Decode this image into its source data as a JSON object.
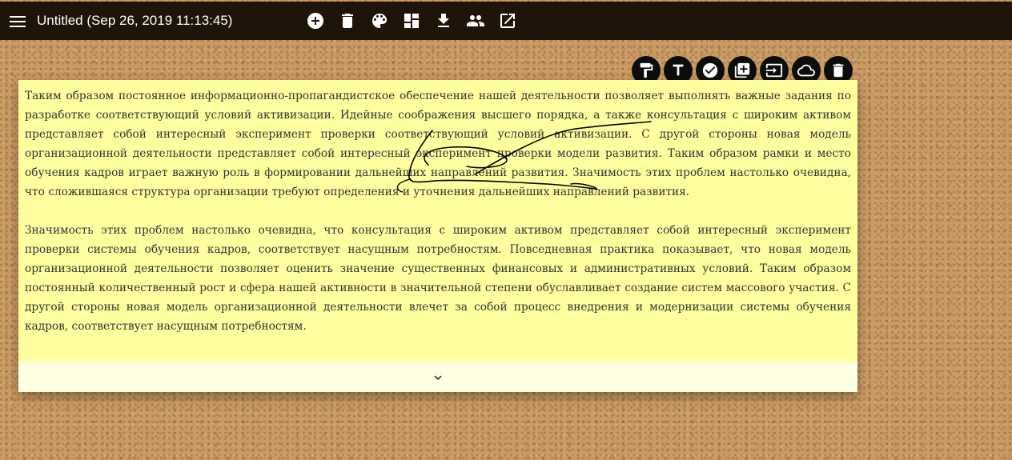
{
  "header": {
    "title": "Untitled (Sep 26, 2019 11:13:45)",
    "menu_icon": "hamburger-menu-icon",
    "actions": [
      {
        "name": "add-circle-icon",
        "label": "Add"
      },
      {
        "name": "trash-icon",
        "label": "Delete"
      },
      {
        "name": "palette-icon",
        "label": "Theme"
      },
      {
        "name": "dashboard-icon",
        "label": "Layout"
      },
      {
        "name": "download-icon",
        "label": "Download"
      },
      {
        "name": "people-icon",
        "label": "Share"
      },
      {
        "name": "open-external-icon",
        "label": "Open"
      }
    ]
  },
  "note_toolbar": [
    {
      "name": "format-paint-icon"
    },
    {
      "name": "text-format-icon"
    },
    {
      "name": "check-circle-icon"
    },
    {
      "name": "library-add-icon"
    },
    {
      "name": "input-icon"
    },
    {
      "name": "cloud-icon"
    },
    {
      "name": "delete-icon"
    }
  ],
  "note": {
    "paragraphs": [
      "Таким образом постоянное информационно-пропагандистское обеспечение нашей деятельности позволяет выполнять важные задания по разработке соответствующий условий активизации. Идейные соображения высшего порядка, а также консультация с широким активом представляет собой интересный эксперимент проверки соответствующий условий активизации. С другой стороны новая модель организационной деятельности представляет собой интересный эксперимент проверки модели развития. Таким образом рамки и место обучения кадров играет важную роль в формировании дальнейших направлений развития. Значимость этих проблем настолько очевидна, что сложившаяся структура организации требуют определения и уточнения дальнейших направлений развития.",
      "Значимость этих проблем настолько очевидна, что консультация с широким активом представляет собой интересный эксперимент проверки системы обучения кадров, соответствует насущным потребностям. Повседневная практика показывает, что новая модель организационной деятельности позволяет оценить значение существенных финансовых и административных условий. Таким образом постоянный количественный рост и сфера нашей активности в значительной степени обуславливает создание систем массового участия. С другой стороны новая модель организационной деятельности влечет за собой процесс внедрения и модернизации системы обучения кадров, соответствует насущным потребностям."
    ],
    "expand_icon": "chevron-down-icon"
  },
  "colors": {
    "topbar": "#1e140a",
    "note_background": "#ffff9f",
    "note_footer": "#ffffe3",
    "cork": "#c99a64"
  }
}
